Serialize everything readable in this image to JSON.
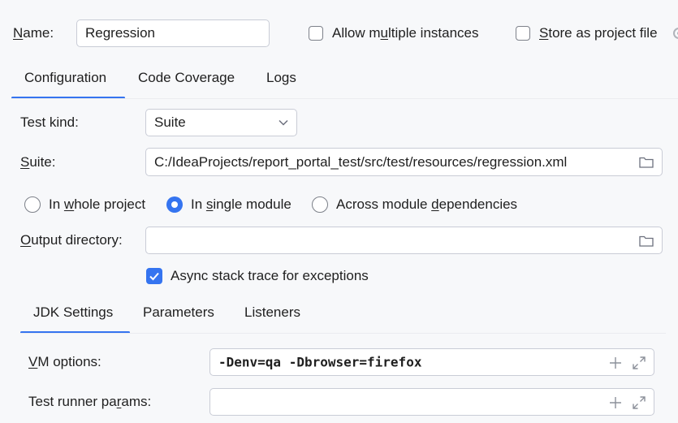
{
  "header": {
    "name_label_u": "N",
    "name_label_rest": "ame:",
    "name_value": "Regression",
    "allow_multiple_pre": "Allow m",
    "allow_multiple_u": "u",
    "allow_multiple_post": "ltiple instances",
    "store_u": "S",
    "store_rest": "tore as project file"
  },
  "tabs": [
    {
      "label": "Configuration",
      "selected": true
    },
    {
      "label": "Code Coverage",
      "selected": false
    },
    {
      "label": "Logs",
      "selected": false
    }
  ],
  "config": {
    "test_kind_label": "Test kind:",
    "test_kind_value": "Suite",
    "suite_label_u": "S",
    "suite_label_rest": "uite:",
    "suite_value": "C:/IdeaProjects/report_portal_test/src/test/resources/regression.xml",
    "scope": {
      "whole_pre": "In ",
      "whole_u": "w",
      "whole_post": "hole project",
      "single_pre": "In ",
      "single_u": "s",
      "single_post": "ingle module",
      "across_pre": "Across module ",
      "across_u": "d",
      "across_post": "ependencies",
      "selected": "single"
    },
    "output_label_u": "O",
    "output_label_rest": "utput directory:",
    "output_value": "",
    "async_label": "Async stack trace for exceptions",
    "async_checked": true
  },
  "subtabs": [
    {
      "label": "JDK Settings",
      "selected": true
    },
    {
      "label": "Parameters",
      "selected": false
    },
    {
      "label": "Listeners",
      "selected": false
    }
  ],
  "jdk": {
    "vm_label_u": "V",
    "vm_label_rest": "M options:",
    "vm_value": "-Denv=qa -Dbrowser=firefox",
    "runner_pre": "Test runner pa",
    "runner_u": "r",
    "runner_post": "ams:",
    "runner_value": ""
  },
  "colors": {
    "accent": "#3574f0",
    "background": "#f7f8fa",
    "field_border": "#c9ccd6"
  }
}
